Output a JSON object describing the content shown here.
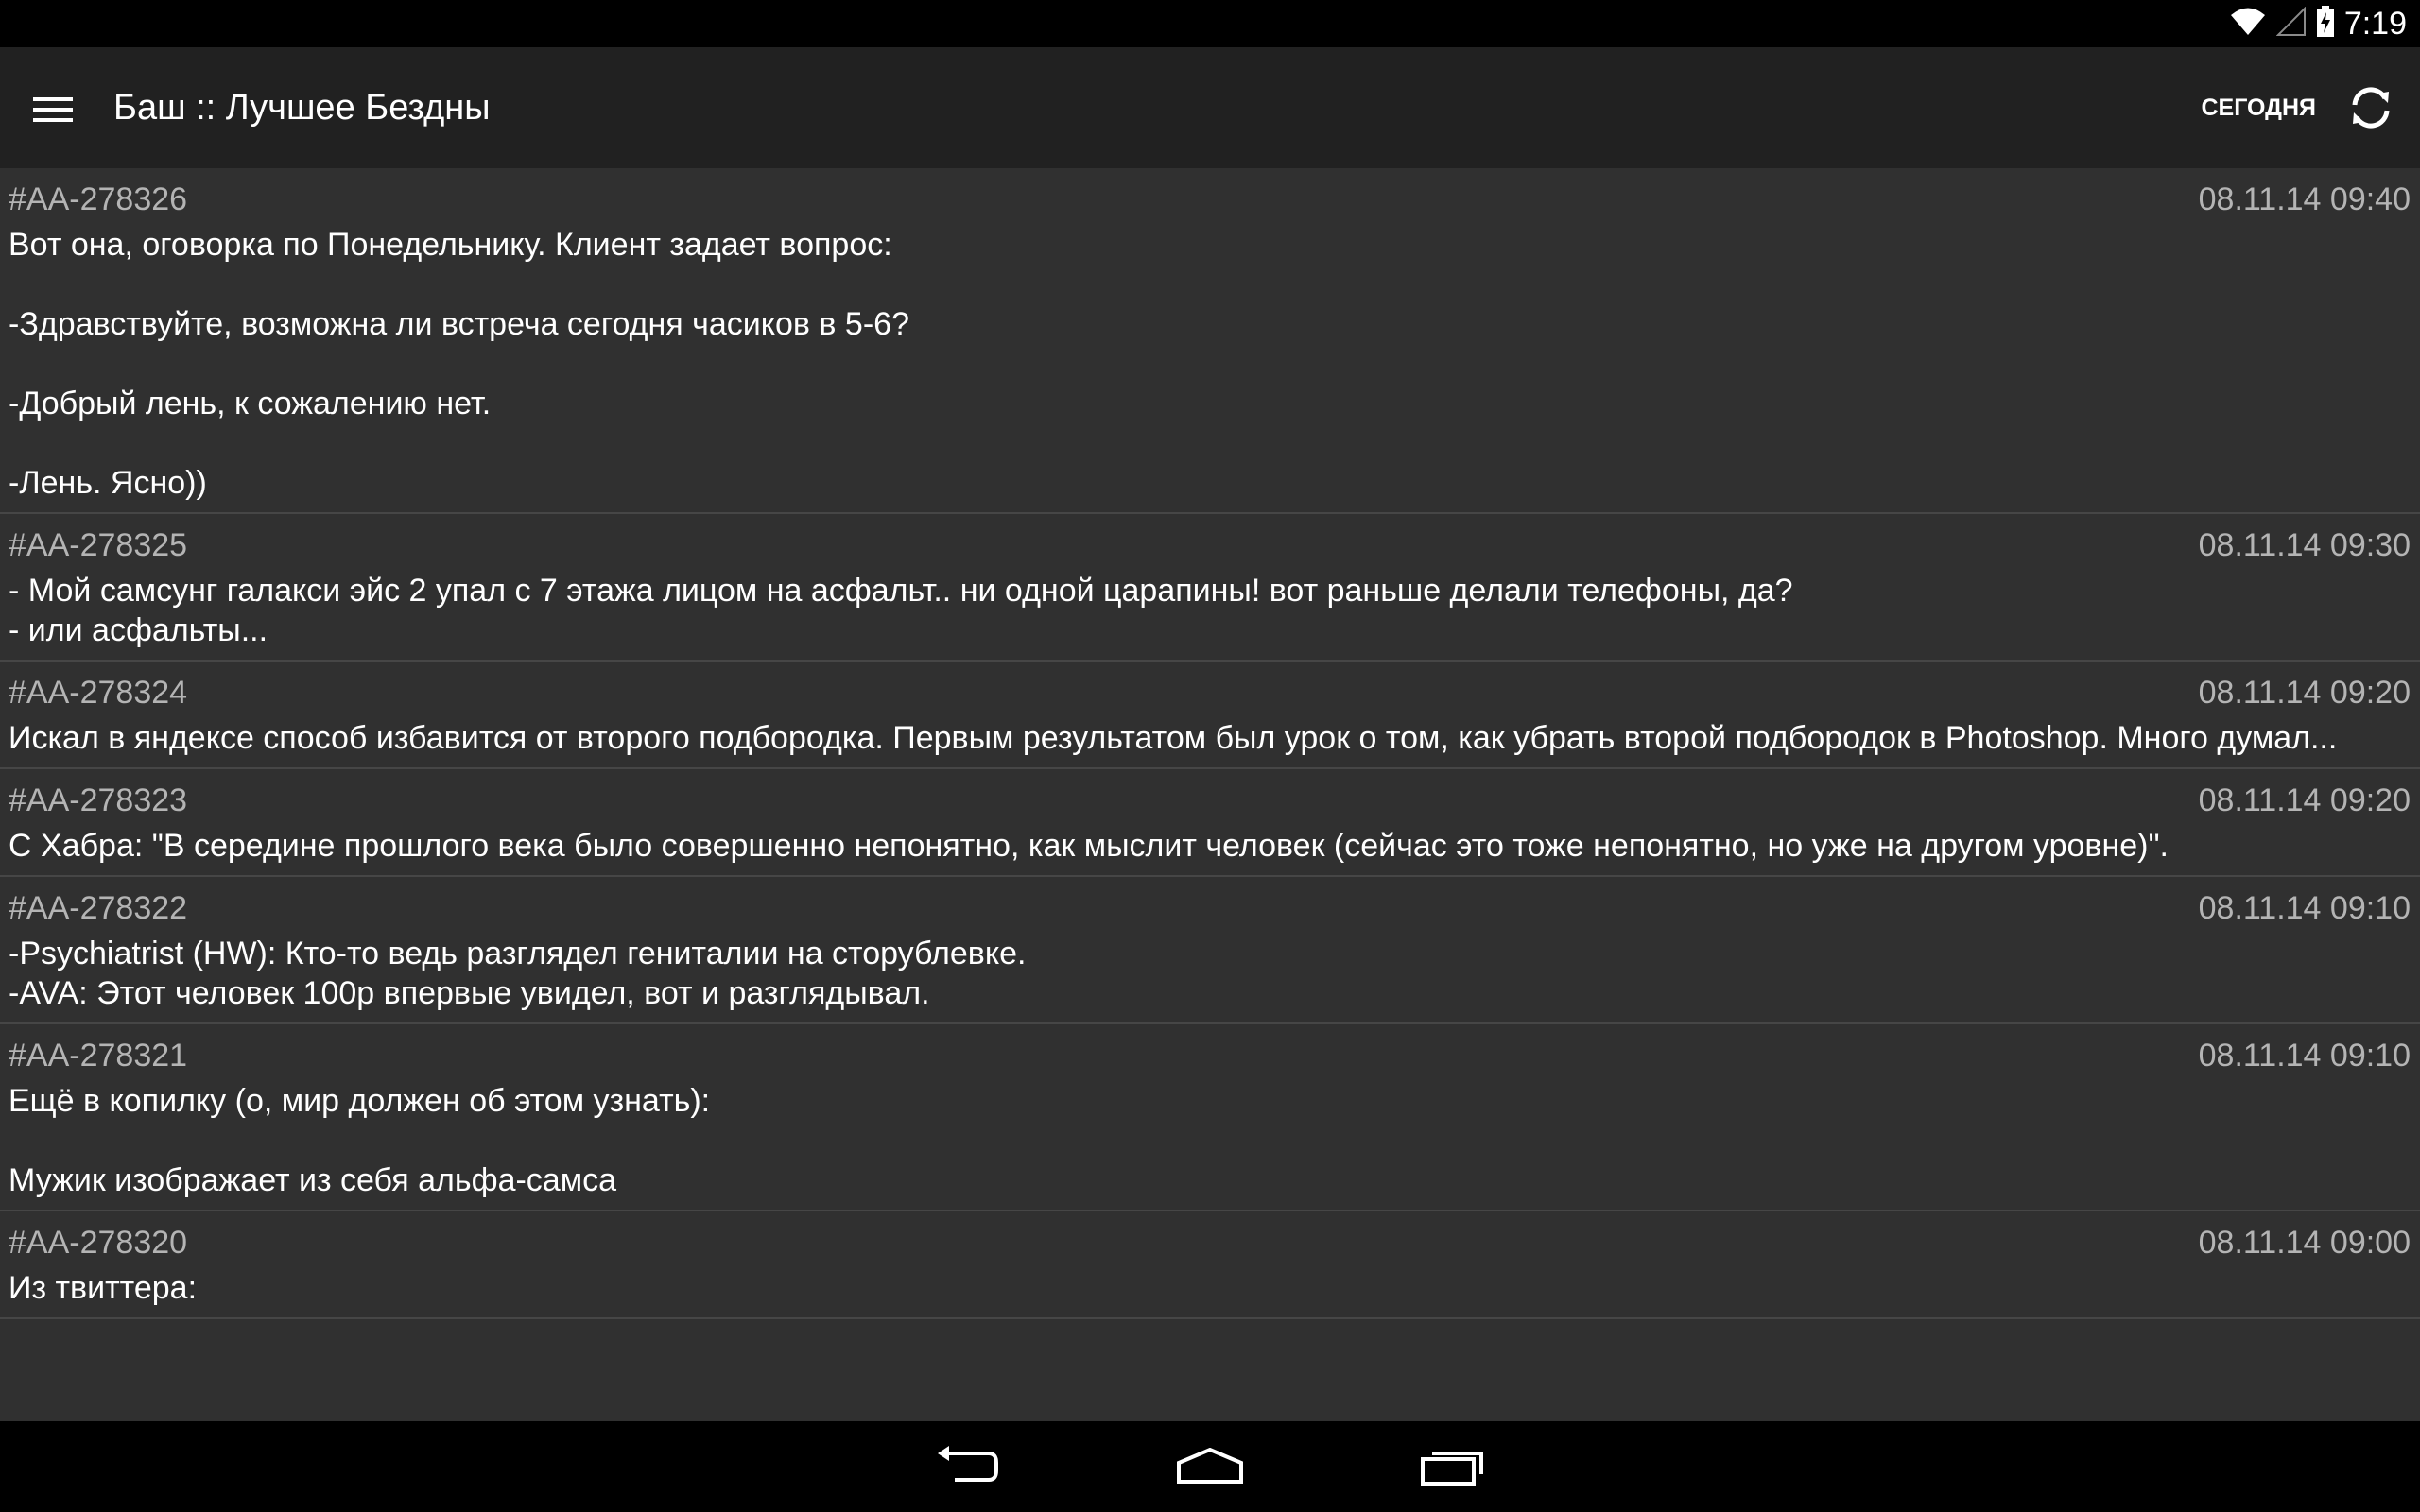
{
  "status_bar": {
    "time": "7:19",
    "icons": [
      "wifi-icon",
      "no-signal-icon",
      "battery-charging-icon"
    ]
  },
  "toolbar": {
    "title": "Баш :: Лучшее Бездны",
    "today_label": "СЕГОДНЯ",
    "menu_icon": "hamburger-menu-icon",
    "refresh_icon": "refresh-icon"
  },
  "quotes": [
    {
      "id": "#AA-278326",
      "date": "08.11.14 09:40",
      "text": "Вот она, оговорка по Понедельнику. Клиент задает вопрос:\n\n-Здравствуйте, возможна ли встреча сегодня часиков в 5-6?\n\n-Добрый лень, к сожалению нет.\n\n-Лень. Ясно))"
    },
    {
      "id": "#AA-278325",
      "date": "08.11.14 09:30",
      "text": "- Мой самсунг галакси эйс 2 упал с 7 этажа лицом на асфальт.. ни одной царапины! вот раньше делали телефоны, да?\n- или асфальты..."
    },
    {
      "id": "#AA-278324",
      "date": "08.11.14 09:20",
      "text": "Искал в яндексе способ избавится от второго подбородка. Первым результатом был урок о том, как убрать второй подбородок в Photoshop. Много думал..."
    },
    {
      "id": "#AA-278323",
      "date": "08.11.14 09:20",
      "text": "С Хабра: \"В середине прошлого века было совершенно непонятно, как мыслит человек (сейчас это тоже непонятно, но уже на другом уровне)\"."
    },
    {
      "id": "#AA-278322",
      "date": "08.11.14 09:10",
      "text": "-Psychiatrist (HW): Кто-то ведь разглядел гениталии на сторублевке.\n-AVA: Этот человек 100р впервые увидел, вот и разглядывал.\n"
    },
    {
      "id": "#AA-278321",
      "date": "08.11.14 09:10",
      "text": "Ещё в копилку (о, мир должен об этом узнать):\n\nМужик изображает из себя альфа-самса"
    },
    {
      "id": "#AA-278320",
      "date": "08.11.14 09:00",
      "text": "Из твиттера:"
    }
  ],
  "nav_bar": {
    "icons": [
      "back-icon",
      "home-icon",
      "recent-apps-icon"
    ]
  },
  "colors": {
    "status_bar": "#000000",
    "toolbar": "#212121",
    "list_background": "#303030",
    "divider": "#464646",
    "meta_text": "#b4b4b4",
    "body_text": "#ffffff"
  }
}
